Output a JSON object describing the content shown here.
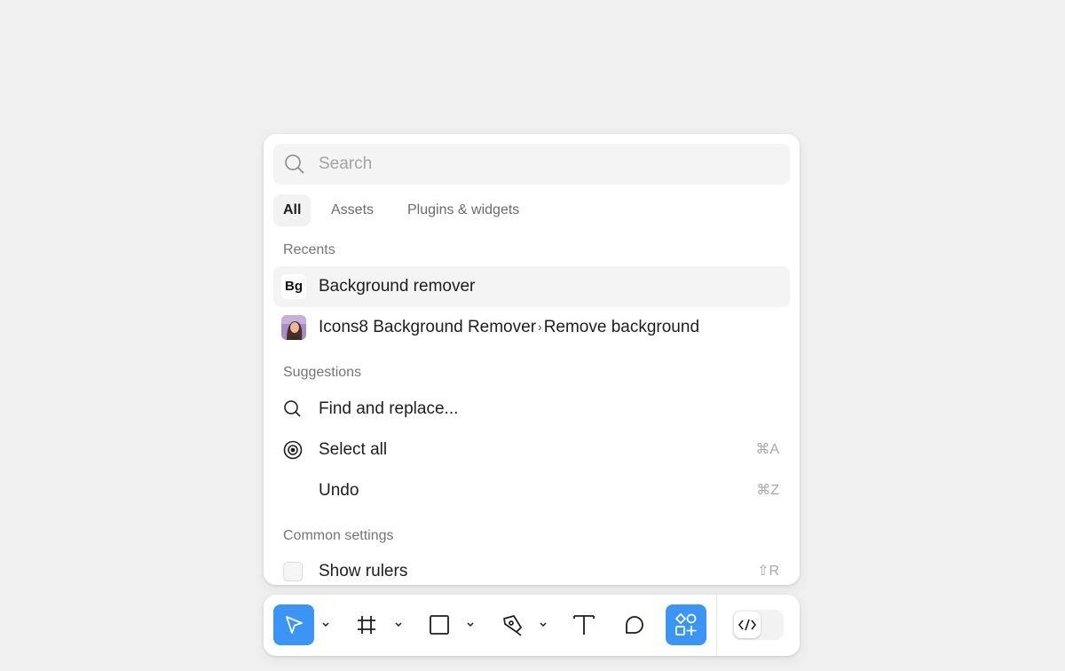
{
  "search": {
    "placeholder": "Search",
    "icon": "search-icon"
  },
  "tabs": [
    {
      "label": "All",
      "active": true
    },
    {
      "label": "Assets",
      "active": false
    },
    {
      "label": "Plugins & widgets",
      "active": false
    }
  ],
  "recents": {
    "title": "Recents",
    "items": [
      {
        "logo_text": "Bg",
        "label": "Background remover",
        "icon": "bg-plugin-logo"
      },
      {
        "label": "Icons8 Background Remover",
        "sub_label": "Remove background",
        "icon": "icons8-avatar"
      }
    ]
  },
  "suggestions": {
    "title": "Suggestions",
    "items": [
      {
        "label": "Find and replace...",
        "shortcut": "",
        "icon": "search-icon"
      },
      {
        "label": "Select all",
        "shortcut": "⌘A",
        "icon": "target-icon"
      },
      {
        "label": "Undo",
        "shortcut": "⌘Z",
        "icon": ""
      }
    ]
  },
  "common_settings": {
    "title": "Common settings",
    "items": [
      {
        "label": "Show rulers",
        "shortcut": "⇧R",
        "icon": "checkbox"
      }
    ]
  },
  "toolbar": {
    "tools": [
      "move-tool-icon",
      "frame-tool-icon",
      "rectangle-tool-icon",
      "pen-tool-icon",
      "text-tool-icon",
      "comment-tool-icon",
      "actions-icon"
    ],
    "active_color": "#3b95f5",
    "dev_mode_icon": "code-icon"
  }
}
